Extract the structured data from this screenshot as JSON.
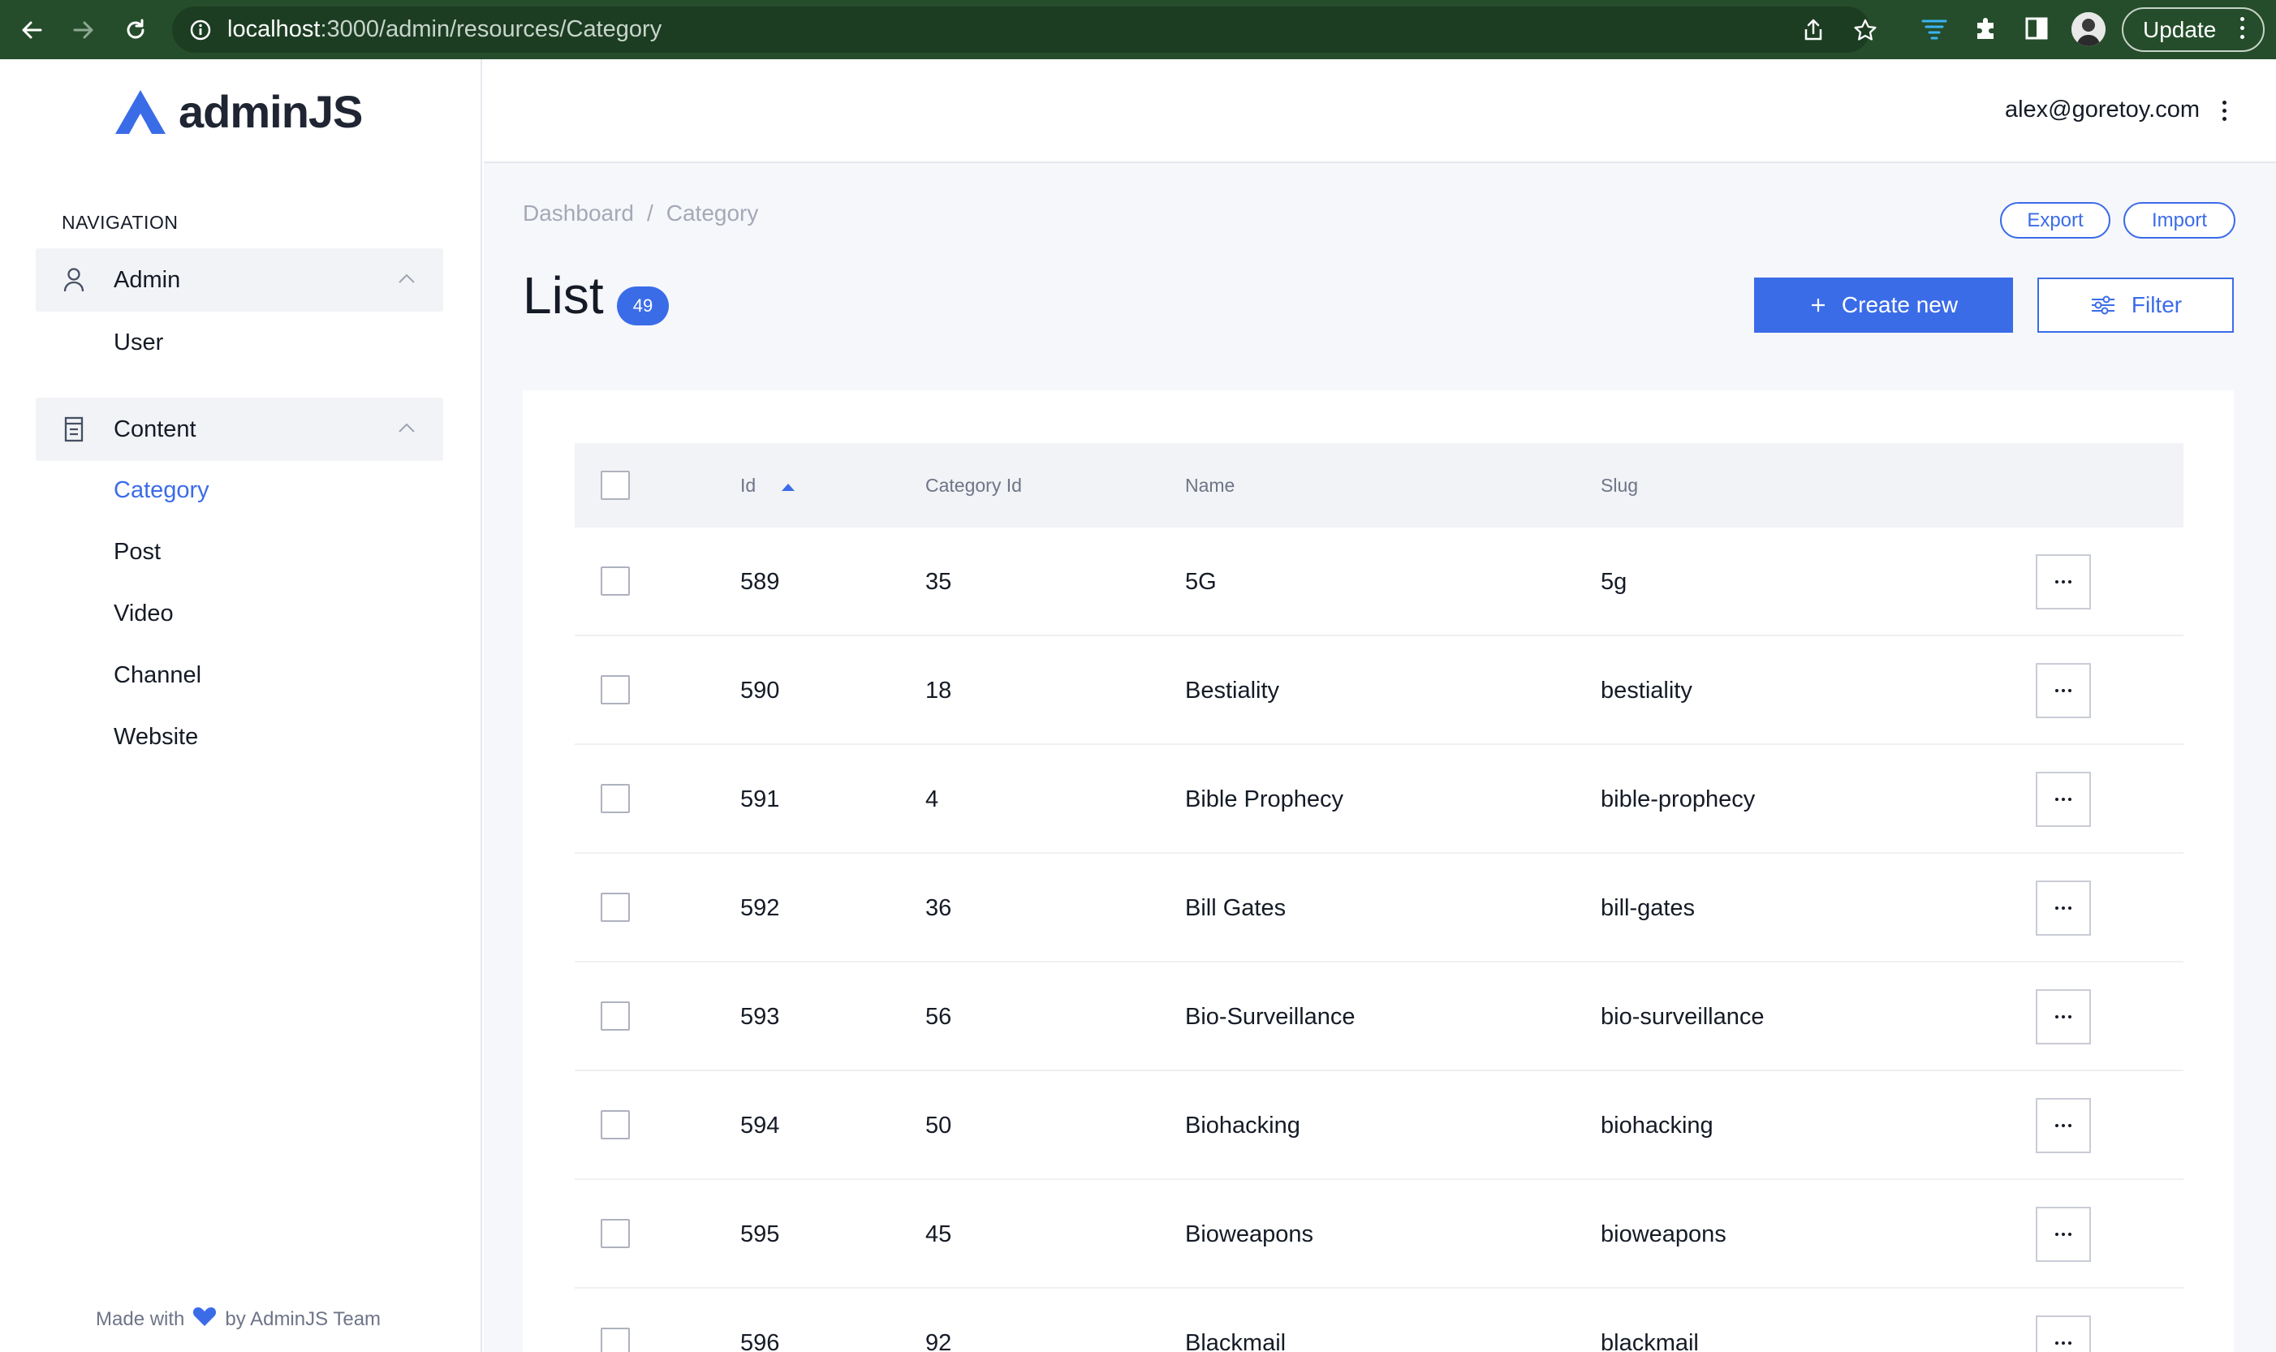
{
  "browser": {
    "url_host": "localhost",
    "url_path": ":3000/admin/resources/Category",
    "update_label": "Update"
  },
  "sidebar": {
    "logo_text": "adminJS",
    "nav_heading": "NAVIGATION",
    "groups": [
      {
        "label": "Admin",
        "icon": "user-icon",
        "items": [
          "User"
        ]
      },
      {
        "label": "Content",
        "icon": "document-icon",
        "items": [
          "Category",
          "Post",
          "Video",
          "Channel",
          "Website"
        ]
      }
    ],
    "footer": {
      "made_with": "Made with",
      "by": "by AdminJS Team"
    }
  },
  "topbar": {
    "user_email": "alex@goretoy.com"
  },
  "main": {
    "breadcrumb": {
      "root": "Dashboard",
      "separator": "/",
      "current": "Category"
    },
    "export_label": "Export",
    "import_label": "Import",
    "title": "List",
    "count": "49",
    "create_label": "Create new",
    "filter_label": "Filter"
  },
  "table": {
    "columns": [
      "Id",
      "Category Id",
      "Name",
      "Slug"
    ],
    "rows": [
      {
        "id": "589",
        "category_id": "35",
        "name": "5G",
        "slug": "5g"
      },
      {
        "id": "590",
        "category_id": "18",
        "name": "Bestiality",
        "slug": "bestiality"
      },
      {
        "id": "591",
        "category_id": "4",
        "name": "Bible Prophecy",
        "slug": "bible-prophecy"
      },
      {
        "id": "592",
        "category_id": "36",
        "name": "Bill Gates",
        "slug": "bill-gates"
      },
      {
        "id": "593",
        "category_id": "56",
        "name": "Bio-Surveillance",
        "slug": "bio-surveillance"
      },
      {
        "id": "594",
        "category_id": "50",
        "name": "Biohacking",
        "slug": "biohacking"
      },
      {
        "id": "595",
        "category_id": "45",
        "name": "Bioweapons",
        "slug": "bioweapons"
      },
      {
        "id": "596",
        "category_id": "92",
        "name": "Blackmail",
        "slug": "blackmail"
      }
    ]
  },
  "colors": {
    "accent": "#3b6ce8",
    "chrome": "#254d2b",
    "background": "#f6f7fb"
  }
}
